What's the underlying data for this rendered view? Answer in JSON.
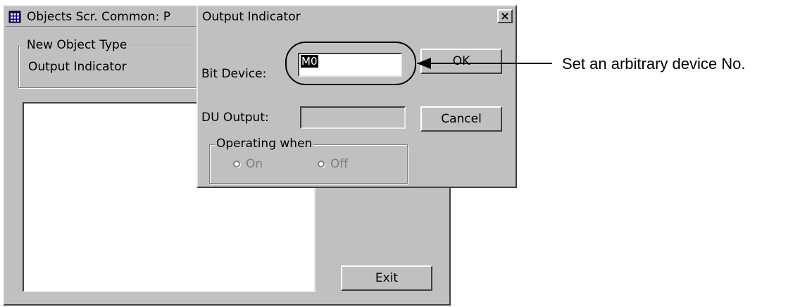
{
  "background_window": {
    "title": "Objects Scr. Common: P",
    "group_label": "New Object Type",
    "object_type": "Output Indicator",
    "exit_button": "Exit"
  },
  "dialog": {
    "title": "Output Indicator",
    "close_glyph": "×",
    "bit_device_label": "Bit Device:",
    "bit_device_value": "M0",
    "du_output_label": "DU Output:",
    "du_output_value": "",
    "ok_button": "OK",
    "cancel_button": "Cancel",
    "operating_when_label": "Operating when",
    "radio_on": "On",
    "radio_off": "Off"
  },
  "annotation": {
    "text": "Set an arbitrary device No."
  },
  "icons": {
    "app_icon": "grid-window-icon",
    "close": "close-icon"
  }
}
